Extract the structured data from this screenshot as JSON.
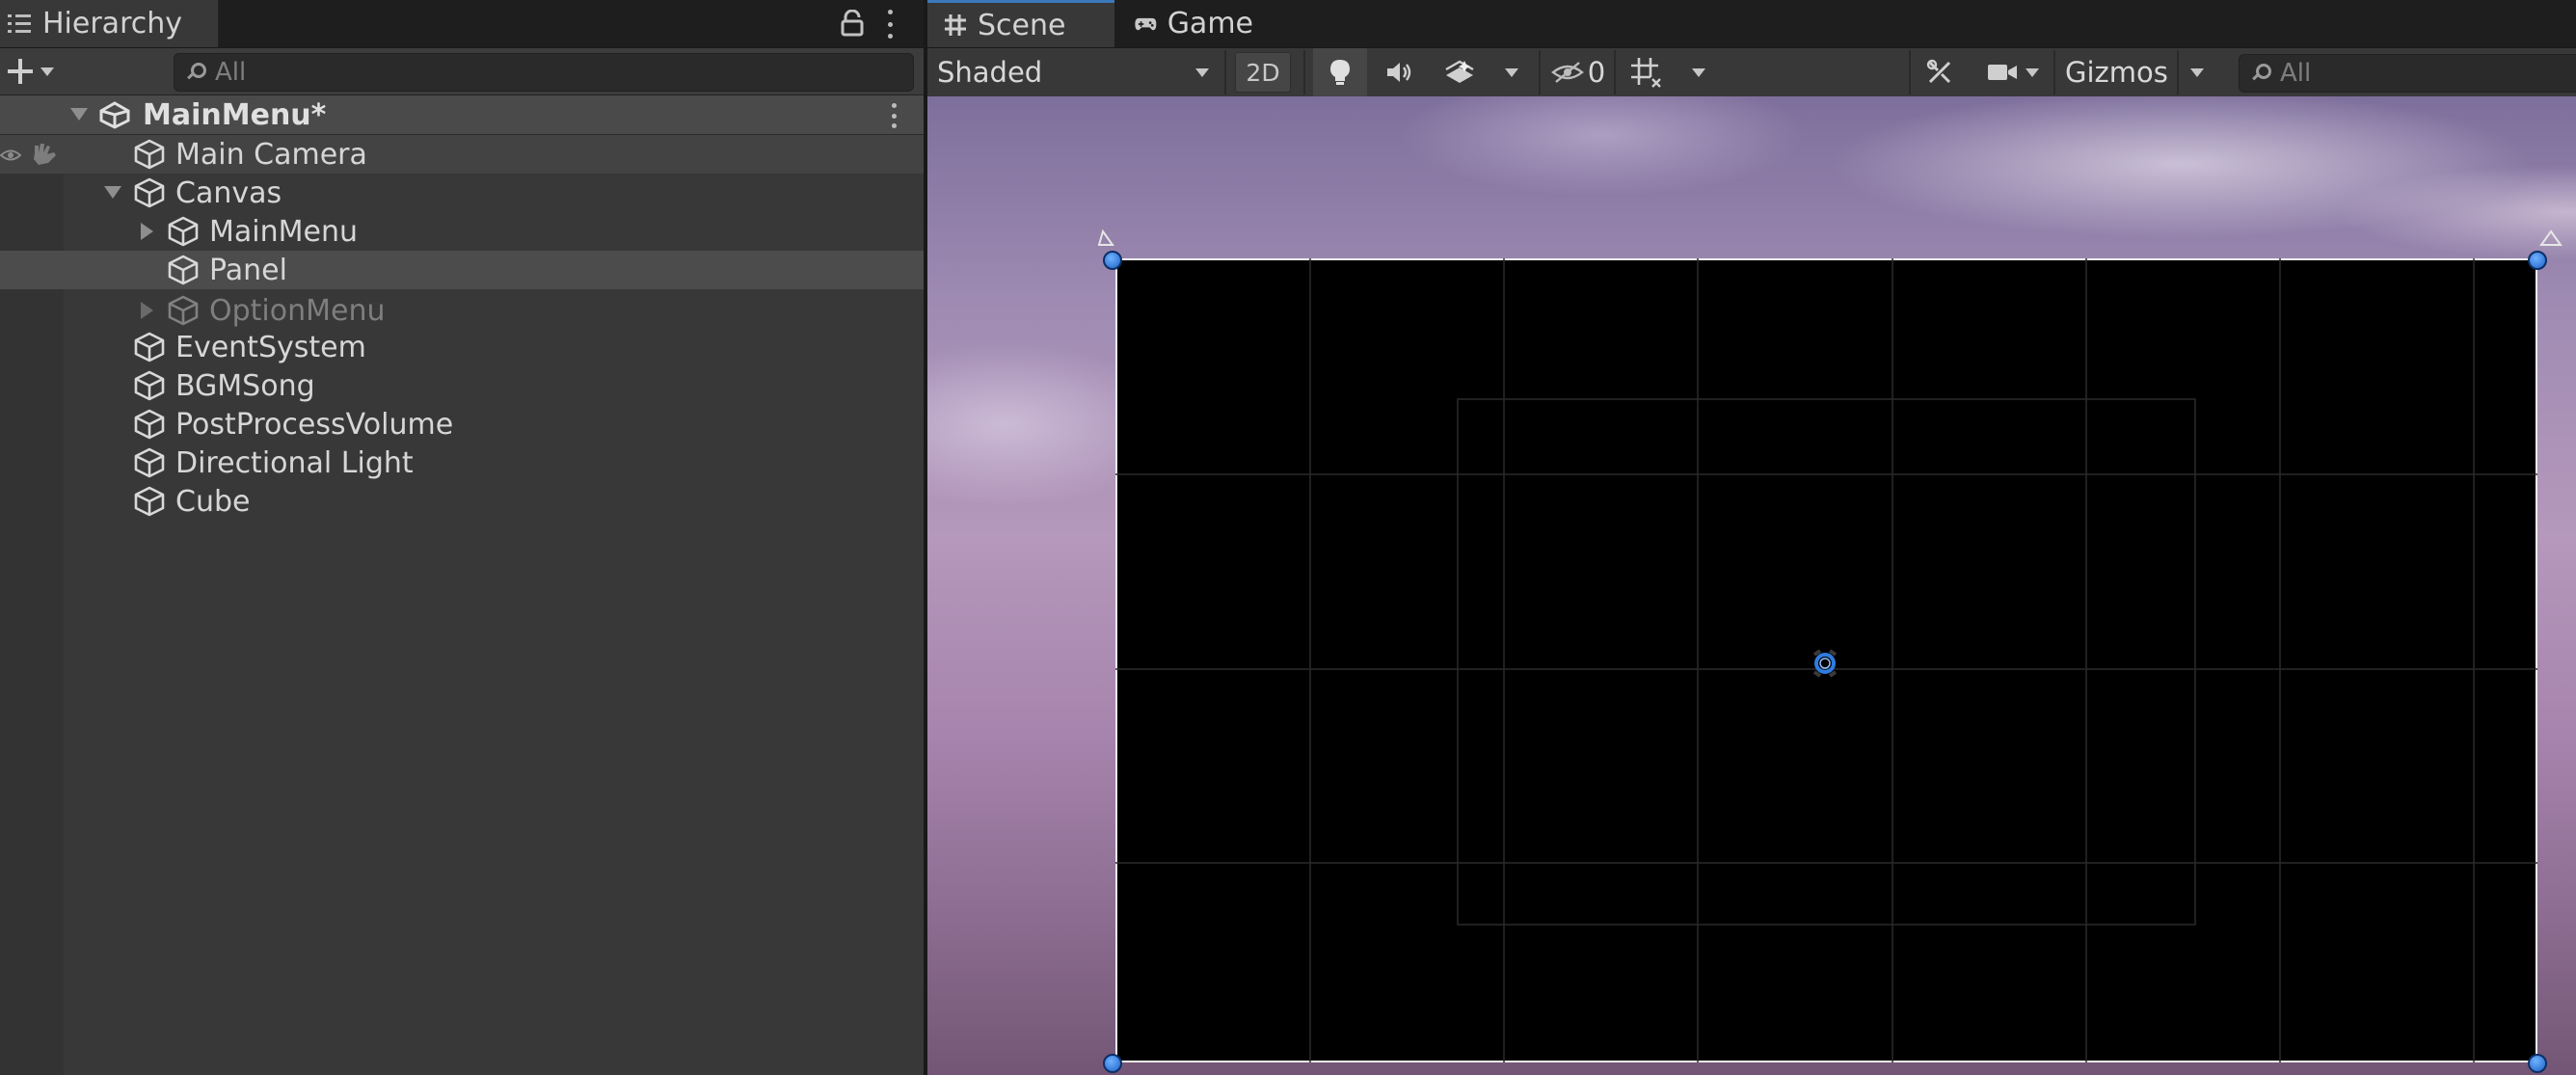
{
  "hierarchy": {
    "title": "Hierarchy",
    "search_placeholder": "All",
    "scene_name": "MainMenu*",
    "items": [
      {
        "label": "Main Camera"
      },
      {
        "label": "Canvas"
      },
      {
        "label": "MainMenu"
      },
      {
        "label": "Panel"
      },
      {
        "label": "OptionMenu"
      },
      {
        "label": "EventSystem"
      },
      {
        "label": "BGMSong"
      },
      {
        "label": "PostProcessVolume"
      },
      {
        "label": "Directional Light"
      },
      {
        "label": "Cube"
      }
    ]
  },
  "tabs": {
    "scene": "Scene",
    "game": "Game"
  },
  "scene_toolbar": {
    "draw_mode": "Shaded",
    "mode_2d": "2D",
    "hidden_count": "0",
    "gizmos": "Gizmos",
    "search_placeholder": "All"
  },
  "icons": [
    "hierarchy-list-icon",
    "lock-icon",
    "kebab-menu-icon",
    "plus-icon",
    "search-icon",
    "unity-scene-icon",
    "gameobject-cube-icon",
    "visibility-eye-icon",
    "pickable-hand-icon",
    "grid-icon",
    "gamepad-icon",
    "lightbulb-icon",
    "audio-icon",
    "effects-icon",
    "hidden-eye-icon",
    "grid-snap-icon",
    "tools-icon",
    "camera-icon"
  ],
  "colors": {
    "panel_bg": "#383838",
    "selected_row": "#4c4c4c",
    "active_tab_accent": "#3a79bb",
    "handle_blue": "#1e62c8"
  }
}
